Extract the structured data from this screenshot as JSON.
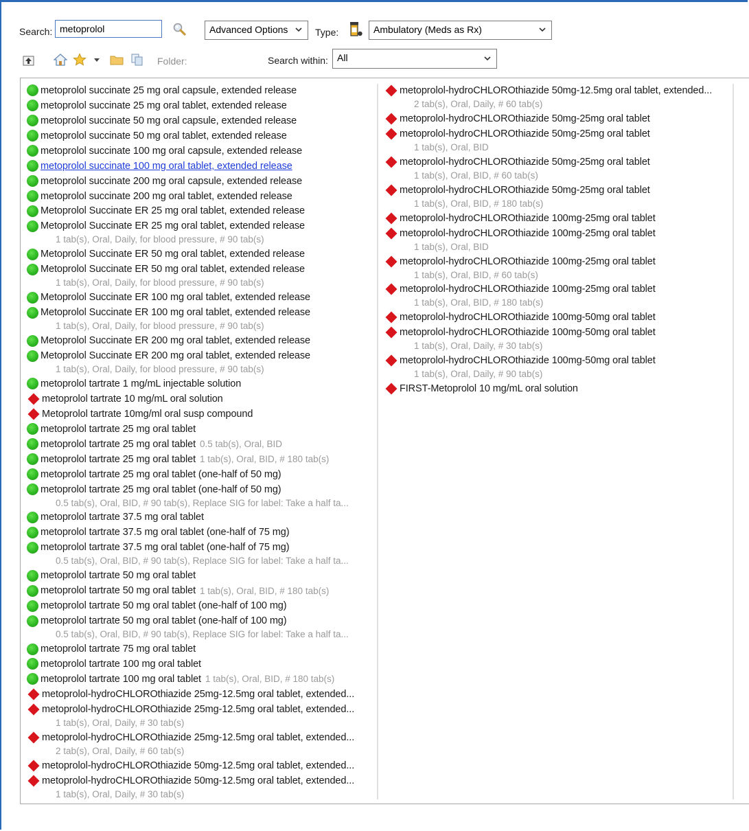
{
  "toolbar": {
    "search_label": "Search:",
    "search_value": "metoprolol",
    "advanced_options": "Advanced Options",
    "type_label": "Type:",
    "type_value": "Ambulatory (Meds as Rx)",
    "folder_label": "Folder:",
    "search_within_label": "Search within:",
    "search_within_value": "All"
  },
  "colors": {
    "accent": "#2a6ab8",
    "green_status": "#2fb823",
    "red_status": "#d8141c",
    "sig_text": "#9a9a9a",
    "link": "#1f3cd8"
  },
  "results": {
    "left": [
      {
        "icon": "green",
        "name": "metoprolol succinate 25 mg oral capsule, extended release"
      },
      {
        "icon": "green",
        "name": "metoprolol succinate 25 mg oral tablet, extended release"
      },
      {
        "icon": "green",
        "name": "metoprolol succinate 50 mg oral capsule, extended release"
      },
      {
        "icon": "green",
        "name": "metoprolol succinate 50 mg oral tablet, extended release"
      },
      {
        "icon": "green",
        "name": "metoprolol succinate 100 mg oral capsule, extended release"
      },
      {
        "icon": "green",
        "name": "metoprolol succinate 100 mg oral tablet, extended release",
        "link": true
      },
      {
        "icon": "green",
        "name": "metoprolol succinate 200 mg oral capsule, extended release"
      },
      {
        "icon": "green",
        "name": "metoprolol succinate 200 mg oral tablet, extended release"
      },
      {
        "icon": "green",
        "name": "Metoprolol Succinate ER 25 mg oral tablet, extended release"
      },
      {
        "icon": "green",
        "name": "Metoprolol Succinate ER 25 mg oral tablet, extended release",
        "sig": "1 tab(s), Oral, Daily, for blood pressure, # 90 tab(s)"
      },
      {
        "icon": "green",
        "name": "Metoprolol Succinate ER 50 mg oral tablet, extended release"
      },
      {
        "icon": "green",
        "name": "Metoprolol Succinate ER 50 mg oral tablet, extended release",
        "sig": "1 tab(s), Oral, Daily, for blood pressure, # 90 tab(s)"
      },
      {
        "icon": "green",
        "name": "Metoprolol Succinate ER 100 mg oral tablet, extended release"
      },
      {
        "icon": "green",
        "name": "Metoprolol Succinate ER 100 mg oral tablet, extended release",
        "sig": "1 tab(s), Oral, Daily, for blood pressure, # 90 tab(s)"
      },
      {
        "icon": "green",
        "name": "Metoprolol Succinate ER 200 mg oral tablet, extended release"
      },
      {
        "icon": "green",
        "name": "Metoprolol Succinate ER 200 mg oral tablet, extended release",
        "sig": "1 tab(s), Oral, Daily, for blood pressure, # 90 tab(s)"
      },
      {
        "icon": "green",
        "name": "metoprolol tartrate 1 mg/mL injectable solution"
      },
      {
        "icon": "red",
        "name": "metoprolol tartrate 10 mg/mL oral solution"
      },
      {
        "icon": "red",
        "name": "Metoprolol tartrate 10mg/ml oral susp compound"
      },
      {
        "icon": "green",
        "name": "metoprolol tartrate 25 mg oral tablet"
      },
      {
        "icon": "green",
        "name": "metoprolol tartrate 25 mg oral tablet",
        "inline": "0.5 tab(s), Oral, BID"
      },
      {
        "icon": "green",
        "name": "metoprolol tartrate 25 mg oral tablet",
        "inline": "1 tab(s), Oral, BID, # 180 tab(s)"
      },
      {
        "icon": "green",
        "name": "metoprolol tartrate 25 mg oral tablet (one-half of 50 mg)"
      },
      {
        "icon": "green",
        "name": "metoprolol tartrate 25 mg oral tablet (one-half of 50 mg)",
        "sig": "0.5 tab(s), Oral, BID, # 90 tab(s), Replace SIG for label: Take a half ta..."
      },
      {
        "icon": "green",
        "name": "metoprolol tartrate 37.5 mg oral tablet"
      },
      {
        "icon": "green",
        "name": "metoprolol tartrate 37.5 mg oral tablet (one-half of 75 mg)"
      },
      {
        "icon": "green",
        "name": "metoprolol tartrate 37.5 mg oral tablet (one-half of 75 mg)",
        "sig": "0.5 tab(s), Oral, BID, # 90 tab(s), Replace SIG for label: Take a half ta..."
      },
      {
        "icon": "green",
        "name": "metoprolol tartrate 50 mg oral tablet"
      },
      {
        "icon": "green",
        "name": "metoprolol tartrate 50 mg oral tablet",
        "inline": "1 tab(s), Oral, BID, # 180 tab(s)"
      },
      {
        "icon": "green",
        "name": "metoprolol tartrate 50 mg oral tablet (one-half of 100 mg)"
      },
      {
        "icon": "green",
        "name": "metoprolol tartrate 50 mg oral tablet (one-half of 100 mg)",
        "sig": "0.5 tab(s), Oral, BID, # 90 tab(s), Replace SIG for label: Take a half ta..."
      },
      {
        "icon": "green",
        "name": "metoprolol tartrate 75 mg oral tablet"
      },
      {
        "icon": "green",
        "name": "metoprolol tartrate 100 mg oral tablet"
      },
      {
        "icon": "green",
        "name": "metoprolol tartrate 100 mg oral tablet",
        "inline": "1 tab(s), Oral, BID, # 180 tab(s)"
      },
      {
        "icon": "red",
        "name": "metoprolol-hydroCHLOROthiazide 25mg-12.5mg oral tablet, extended..."
      },
      {
        "icon": "red",
        "name": "metoprolol-hydroCHLOROthiazide 25mg-12.5mg oral tablet, extended...",
        "sig": "1 tab(s), Oral, Daily, # 30 tab(s)"
      },
      {
        "icon": "red",
        "name": "metoprolol-hydroCHLOROthiazide 25mg-12.5mg oral tablet, extended...",
        "sig": "2 tab(s), Oral, Daily, # 60 tab(s)"
      },
      {
        "icon": "red",
        "name": "metoprolol-hydroCHLOROthiazide 50mg-12.5mg oral tablet, extended..."
      },
      {
        "icon": "red",
        "name": "metoprolol-hydroCHLOROthiazide 50mg-12.5mg oral tablet, extended...",
        "sig": "1 tab(s), Oral, Daily, # 30 tab(s)"
      }
    ],
    "right": [
      {
        "icon": "red",
        "name": "metoprolol-hydroCHLOROthiazide 50mg-12.5mg oral tablet, extended...",
        "sig": "2 tab(s), Oral, Daily, # 60 tab(s)"
      },
      {
        "icon": "red",
        "name": "metoprolol-hydroCHLOROthiazide 50mg-25mg oral tablet"
      },
      {
        "icon": "red",
        "name": "metoprolol-hydroCHLOROthiazide 50mg-25mg oral tablet",
        "sig": "1 tab(s), Oral, BID"
      },
      {
        "icon": "red",
        "name": "metoprolol-hydroCHLOROthiazide 50mg-25mg oral tablet",
        "sig": "1 tab(s), Oral, BID, # 60 tab(s)"
      },
      {
        "icon": "red",
        "name": "metoprolol-hydroCHLOROthiazide 50mg-25mg oral tablet",
        "sig": "1 tab(s), Oral, BID, # 180 tab(s)"
      },
      {
        "icon": "red",
        "name": "metoprolol-hydroCHLOROthiazide 100mg-25mg oral tablet"
      },
      {
        "icon": "red",
        "name": "metoprolol-hydroCHLOROthiazide 100mg-25mg oral tablet",
        "sig": "1 tab(s), Oral, BID"
      },
      {
        "icon": "red",
        "name": "metoprolol-hydroCHLOROthiazide 100mg-25mg oral tablet",
        "sig": "1 tab(s), Oral, BID, # 60 tab(s)"
      },
      {
        "icon": "red",
        "name": "metoprolol-hydroCHLOROthiazide 100mg-25mg oral tablet",
        "sig": "1 tab(s), Oral, BID, # 180 tab(s)"
      },
      {
        "icon": "red",
        "name": "metoprolol-hydroCHLOROthiazide 100mg-50mg oral tablet"
      },
      {
        "icon": "red",
        "name": "metoprolol-hydroCHLOROthiazide 100mg-50mg oral tablet",
        "sig": "1 tab(s), Oral, Daily, # 30 tab(s)"
      },
      {
        "icon": "red",
        "name": "metoprolol-hydroCHLOROthiazide 100mg-50mg oral tablet",
        "sig": "1 tab(s), Oral, Daily, # 90 tab(s)"
      },
      {
        "icon": "red",
        "name": "FIRST-Metoprolol 10 mg/mL oral solution"
      }
    ]
  }
}
